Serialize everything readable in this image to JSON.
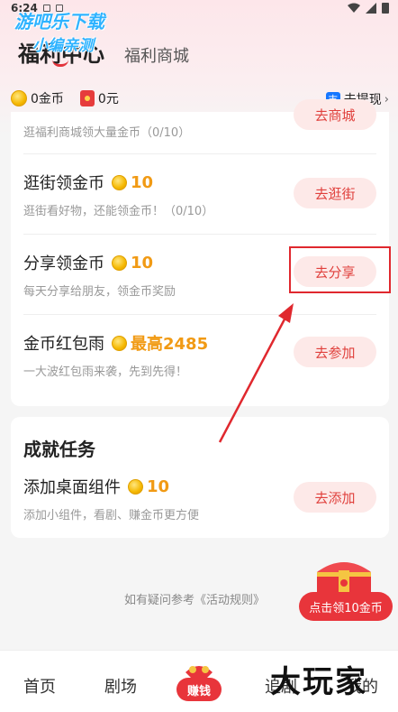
{
  "status": {
    "time": "6:24"
  },
  "watermark": {
    "line1": "游吧乐下载",
    "line2": "小编亲测",
    "brand": "大玩家"
  },
  "tabs": {
    "active": "福利中心",
    "inactive": "福利商城"
  },
  "balance": {
    "coins": "0金币",
    "cash": "0元",
    "withdraw": "去提现",
    "withdraw_icon": "支"
  },
  "tasks_partial": {
    "desc": "逛福利商城领大量金币（0/10）",
    "button": "去商城"
  },
  "tasks": [
    {
      "title": "逛街领金币",
      "reward": "10",
      "desc": "逛街看好物，还能领金币！（0/10）",
      "button": "去逛街"
    },
    {
      "title": "分享领金币",
      "reward": "10",
      "desc": "每天分享给朋友，领金币奖励",
      "button": "去分享"
    },
    {
      "title": "金币红包雨",
      "reward": "最高2485",
      "desc": "一大波红包雨来袭，先到先得！",
      "button": "去参加"
    }
  ],
  "achievement": {
    "title": "成就任务",
    "task": {
      "title": "添加桌面组件",
      "reward": "10",
      "desc": "添加小组件，看剧、赚金币更方便",
      "button": "去添加"
    }
  },
  "footer": {
    "rules": "如有疑问参考《活动规则》",
    "claim": "点击领10金币"
  },
  "nav": {
    "home": "首页",
    "theater": "剧场",
    "earn": "赚钱",
    "follow": "追剧",
    "mine": "我的"
  },
  "colors": {
    "accent": "#e8353b",
    "gold": "#f19a14",
    "highlight": "#e0282e"
  }
}
